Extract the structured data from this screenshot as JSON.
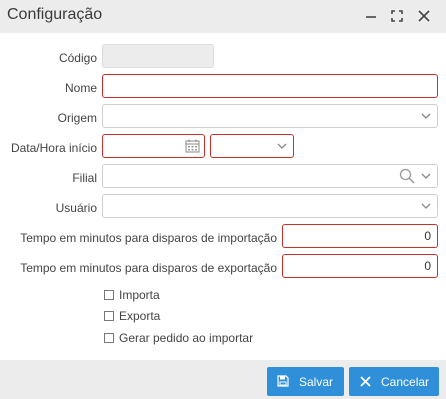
{
  "window": {
    "title": "Configuração"
  },
  "form": {
    "codigo": {
      "label": "Código",
      "value": ""
    },
    "nome": {
      "label": "Nome",
      "value": ""
    },
    "origem": {
      "label": "Origem",
      "selected": ""
    },
    "data_hora_inicio": {
      "label": "Data/Hora início",
      "date_value": "",
      "time_selected": ""
    },
    "filial": {
      "label": "Filial",
      "value": ""
    },
    "usuario": {
      "label": "Usuário",
      "selected": ""
    },
    "tempo_importacao": {
      "label": "Tempo em minutos para disparos de importação",
      "value": "0"
    },
    "tempo_exportacao": {
      "label": "Tempo em minutos para disparos de exportação",
      "value": "0"
    }
  },
  "checkboxes": [
    {
      "label": "Importa",
      "checked": false
    },
    {
      "label": "Exporta",
      "checked": false
    },
    {
      "label": "Gerar pedido ao importar",
      "checked": false
    }
  ],
  "footer": {
    "save_label": "Salvar",
    "cancel_label": "Cancelar"
  },
  "colors": {
    "required_border": "#c9302c",
    "button_blue": "#2f8fd8",
    "titlebar_bg": "#ececec"
  }
}
